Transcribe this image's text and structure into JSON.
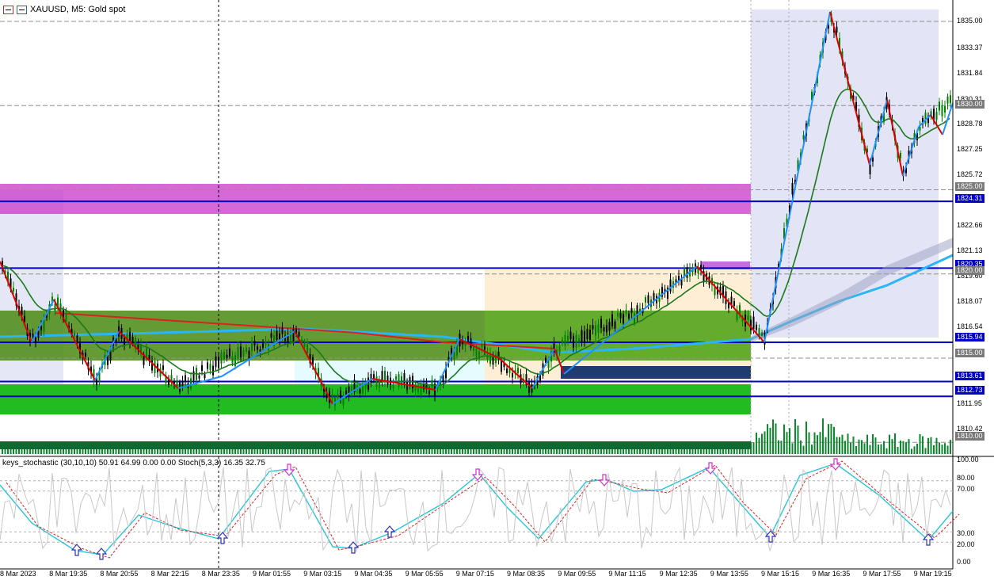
{
  "window": {
    "title": "XAUUSD, M5:  Gold spot",
    "icons": [
      "chart-window-icon",
      "symbol-icon"
    ]
  },
  "indicator_label": "keys_stochastic (30,10,10) 50.91 64.99 0.00 0.00 Stoch(5,3,3) 16.35 32.75",
  "price_axis": {
    "labels": [
      "1835.00",
      "1833.37",
      "1831.84",
      "1830.31",
      "1828.78",
      "1827.25",
      "1825.72",
      "1824.31",
      "1822.66",
      "1821.13",
      "1819.60",
      "1818.07",
      "1816.54",
      "1815.00",
      "1811.95",
      "1810.42",
      "1810.00"
    ],
    "highlighted": [
      {
        "text": "1830.00",
        "color": "#7a7a7a"
      },
      {
        "text": "1825.00",
        "color": "#7a7a7a"
      },
      {
        "text": "1824.31",
        "color": "#0000c8"
      },
      {
        "text": "1820.35",
        "color": "#0000c8"
      },
      {
        "text": "1820.00",
        "color": "#7a7a7a"
      },
      {
        "text": "1815.94",
        "color": "#0000c8"
      },
      {
        "text": "1815.00",
        "color": "#7a7a7a"
      },
      {
        "text": "1813.61",
        "color": "#0000c8"
      },
      {
        "text": "1812.73",
        "color": "#0000c8"
      },
      {
        "text": "1810.00",
        "color": "#7a7a7a"
      }
    ]
  },
  "indicator_axis": {
    "labels": [
      "100.00",
      "80.00",
      "70.00",
      "30.00",
      "20.00",
      "0.00"
    ]
  },
  "time_axis": {
    "labels": [
      "8 Mar 2023",
      "8 Mar 19:35",
      "8 Mar 20:55",
      "8 Mar 22:15",
      "8 Mar 23:35",
      "9 Mar 01:55",
      "9 Mar 03:15",
      "9 Mar 04:35",
      "9 Mar 05:55",
      "9 Mar 07:15",
      "9 Mar 08:35",
      "9 Mar 09:55",
      "9 Mar 11:15",
      "9 Mar 12:35",
      "9 Mar 13:55",
      "9 Mar 15:15",
      "9 Mar 16:35",
      "9 Mar 17:55",
      "9 Mar 19:15"
    ]
  },
  "colors": {
    "bull_candle": "#008000",
    "bear_candle": "#000000",
    "support_line": "#0000c8",
    "resistance_zone": "#cc44cc",
    "demand_zone": "#22bb22",
    "zigzag_up": "#1e90ff",
    "zigzag_down": "#dd0000"
  }
}
